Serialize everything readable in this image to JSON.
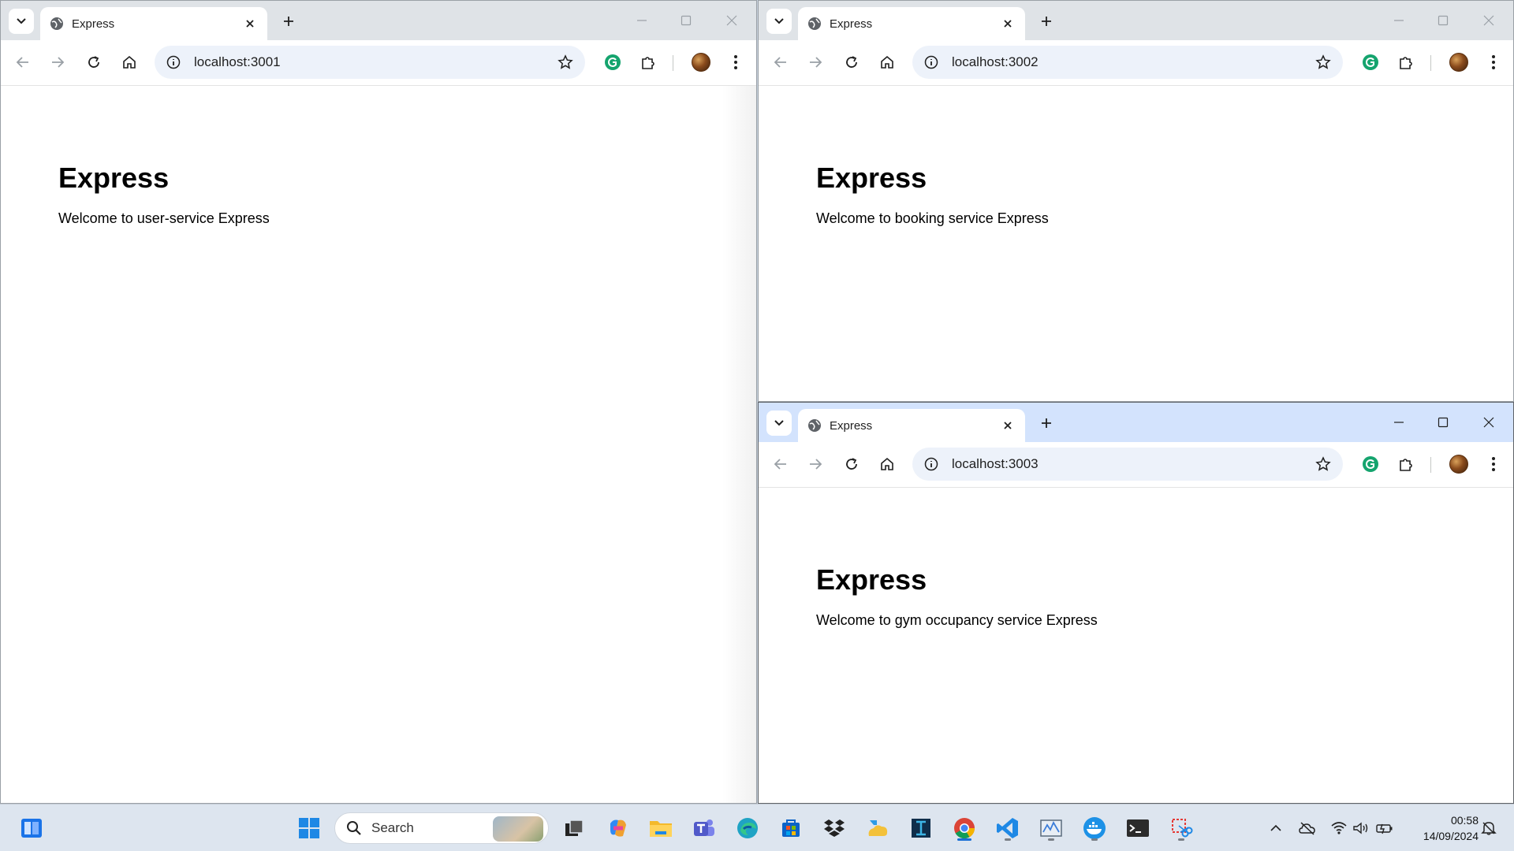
{
  "windows": [
    {
      "tab_title": "Express",
      "url": "localhost:3001",
      "heading": "Express",
      "message": "Welcome to user-service Express"
    },
    {
      "tab_title": "Express",
      "url": "localhost:3002",
      "heading": "Express",
      "message": "Welcome to booking service Express"
    },
    {
      "tab_title": "Express",
      "url": "localhost:3003",
      "heading": "Express",
      "message": "Welcome to gym occupancy service Express"
    }
  ],
  "taskbar": {
    "search_label": "Search",
    "time": "00:58",
    "date": "14/09/2024",
    "apps": [
      "start-icon",
      "search-icon",
      "task-view-icon",
      "copilot-icon",
      "file-explorer-icon",
      "teams-icon",
      "edge-icon",
      "store-icon",
      "dropbox-icon",
      "onedrive-icon",
      "app-icon",
      "chrome-icon",
      "vscode-icon",
      "monitor-icon",
      "docker-icon",
      "terminal-icon",
      "snipping-tool-icon"
    ]
  },
  "colors": {
    "active_tabstrip": "#d3e3fd",
    "inactive_tabstrip": "#dfe3e7",
    "omnibox": "#edf2fa",
    "taskbar": "#dde5ef"
  }
}
